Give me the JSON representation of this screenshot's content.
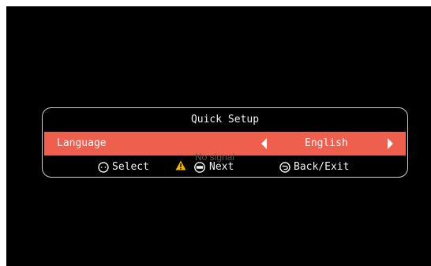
{
  "osd": {
    "title": "Quick Setup",
    "language_label": "Language",
    "language_value": "English",
    "hints": {
      "select": "Select",
      "next": "Next",
      "back_exit": "Back/Exit"
    },
    "status_overlay": "No signal",
    "icons": [
      "dpad-icon",
      "enter-icon",
      "back-icon",
      "warning-icon",
      "arrow-left-icon",
      "arrow-right-icon"
    ],
    "colors": {
      "background": "#000000",
      "highlight": "#ee5f4d",
      "text": "#f2f2f2",
      "warning": "#f0b400"
    }
  }
}
